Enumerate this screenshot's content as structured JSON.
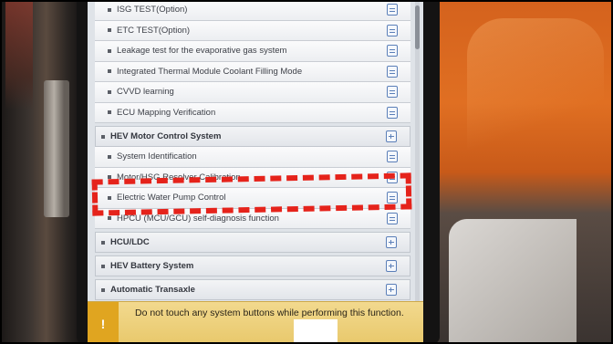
{
  "menu": {
    "items": [
      {
        "type": "sub",
        "label": "ISG TEST(Option)"
      },
      {
        "type": "sub",
        "label": "ETC TEST(Option)"
      },
      {
        "type": "sub",
        "label": "Leakage test for the evaporative gas system"
      },
      {
        "type": "sub",
        "label": "Integrated Thermal Module Coolant Filling Mode"
      },
      {
        "type": "sub",
        "label": "CVVD learning"
      },
      {
        "type": "sub",
        "label": "ECU Mapping Verification"
      },
      {
        "type": "header",
        "label": "HEV Motor Control System"
      },
      {
        "type": "sub",
        "label": "System Identification"
      },
      {
        "type": "sub",
        "label": "Motor/HSG Resolver Calibration"
      },
      {
        "type": "sub",
        "label": "Electric Water Pump Control"
      },
      {
        "type": "sub",
        "label": "HPCU (MCU/GCU) self-diagnosis function"
      },
      {
        "type": "header",
        "label": "HCU/LDC"
      },
      {
        "type": "header",
        "label": "HEV Battery System"
      },
      {
        "type": "header",
        "label": "Automatic Transaxle"
      }
    ]
  },
  "footer": {
    "warning_icon": "!",
    "warning_text": "Do not touch any system buttons while performing this function."
  },
  "colors": {
    "highlight": "#e5231b",
    "footer_bg": "#eed27f",
    "icon_blue": "#5b7fb8"
  },
  "icons": {
    "sub_item": "document-icon",
    "header": "expand-icon",
    "warning": "warning-icon"
  }
}
